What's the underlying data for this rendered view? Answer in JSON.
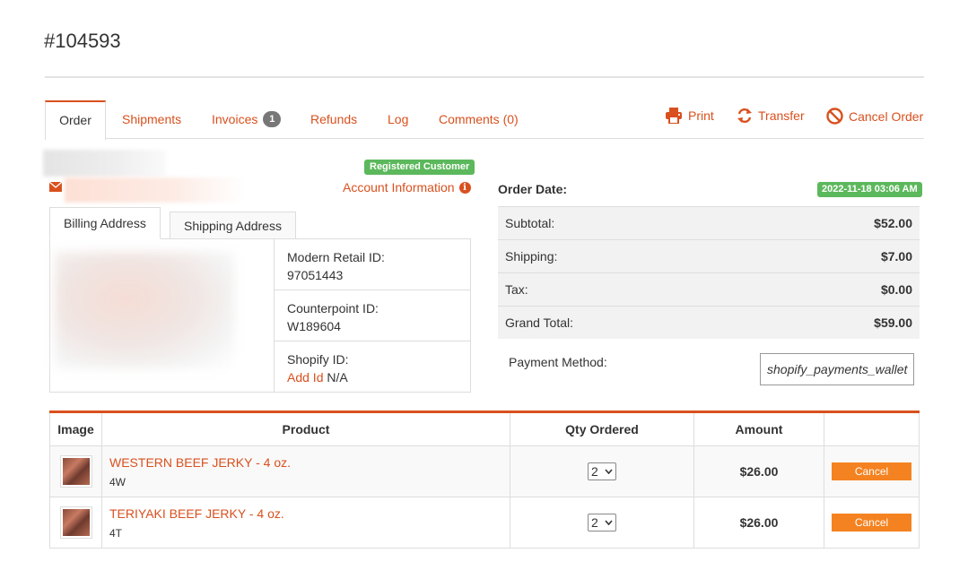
{
  "order": {
    "number": "#104593"
  },
  "tabs": {
    "order": "Order",
    "shipments": "Shipments",
    "invoices": "Invoices",
    "invoices_badge": "1",
    "refunds": "Refunds",
    "log": "Log",
    "comments": "Comments (0)"
  },
  "actions": {
    "print": "Print",
    "transfer": "Transfer",
    "cancel_order": "Cancel Order"
  },
  "icons": {
    "print": "printer-icon",
    "transfer": "refresh-icon",
    "cancel": "ban-icon",
    "email": "envelope-icon",
    "info": "info-icon"
  },
  "customer": {
    "badge": "Registered Customer",
    "account_info": "Account Information"
  },
  "address_tabs": {
    "billing": "Billing Address",
    "shipping": "Shipping Address"
  },
  "ids": {
    "modern_retail_label": "Modern Retail ID:",
    "modern_retail_value": "97051443",
    "counterpoint_label": "Counterpoint ID:",
    "counterpoint_value": "W189604",
    "shopify_label": "Shopify ID:",
    "shopify_add": "Add Id",
    "shopify_value": "N/A"
  },
  "summary": {
    "order_date_label": "Order Date:",
    "order_date": "2022-11-18 03:06 AM",
    "rows": [
      {
        "label": "Subtotal:",
        "value": "$52.00"
      },
      {
        "label": "Shipping:",
        "value": "$7.00"
      },
      {
        "label": "Tax:",
        "value": "$0.00"
      },
      {
        "label": "Grand Total:",
        "value": "$59.00"
      }
    ],
    "payment_label": "Payment Method:",
    "payment_value": "shopify_payments_wallet"
  },
  "products": {
    "headers": {
      "image": "Image",
      "product": "Product",
      "qty": "Qty Ordered",
      "amount": "Amount",
      "action": ""
    },
    "items": [
      {
        "name": "WESTERN BEEF JERKY - 4 oz.",
        "sku": "4W",
        "qty": "2",
        "amount": "$26.00",
        "action": "Cancel"
      },
      {
        "name": "TERIYAKI BEEF JERKY - 4 oz.",
        "sku": "4T",
        "qty": "2",
        "amount": "$26.00",
        "action": "Cancel"
      }
    ]
  },
  "colors": {
    "accent": "#d9501e",
    "success": "#5cb85c",
    "cancel_button": "#f58220"
  }
}
